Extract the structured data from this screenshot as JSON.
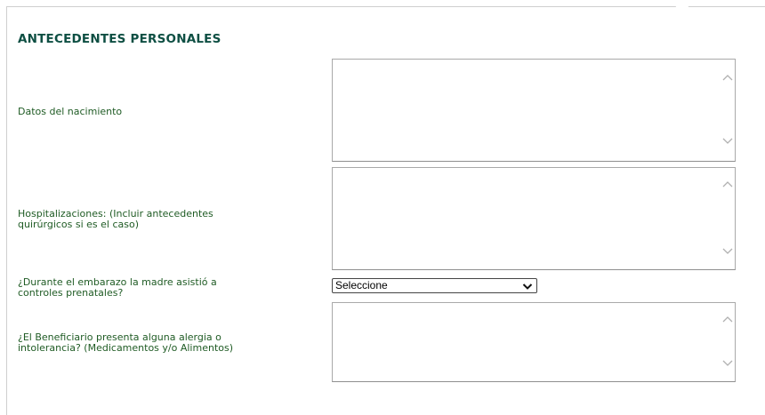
{
  "section": {
    "title": "ANTECEDENTES PERSONALES"
  },
  "fields": {
    "birth": {
      "label": "Datos del nacimiento",
      "value": ""
    },
    "hosp": {
      "label_line1": "Hospitalizaciones: (Incluir antecedentes",
      "label_line2": "quirúrgicos si es el caso)",
      "value": ""
    },
    "prenatal": {
      "label_line1": "¿Durante el embarazo la madre asistió a",
      "label_line2": "controles prenatales?",
      "selected": "Seleccione"
    },
    "allergy": {
      "label_line1": "¿El Beneficiario presenta alguna alergia o",
      "label_line2": "intolerancia? (Medicamentos y/o Alimentos)",
      "value": ""
    }
  },
  "icons": {
    "scroll_up": "chevron-up-icon",
    "scroll_down": "chevron-down-icon",
    "select_arrow": "chevron-down-icon"
  },
  "colors": {
    "title": "#0e4f43",
    "label": "#1f5b24",
    "border": "#a9a9a9"
  }
}
